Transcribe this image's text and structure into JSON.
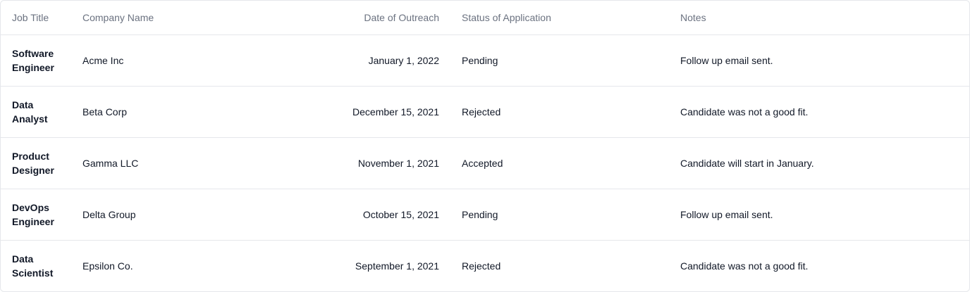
{
  "table": {
    "headers": {
      "job_title": "Job Title",
      "company_name": "Company Name",
      "date_of_outreach": "Date of Outreach",
      "status": "Status of Application",
      "notes": "Notes"
    },
    "rows": [
      {
        "job_title": "Software Engineer",
        "company": "Acme Inc",
        "date": "January 1, 2022",
        "status": "Pending",
        "notes": "Follow up email sent."
      },
      {
        "job_title": "Data Analyst",
        "company": "Beta Corp",
        "date": "December 15, 2021",
        "status": "Rejected",
        "notes": "Candidate was not a good fit."
      },
      {
        "job_title": "Product Designer",
        "company": "Gamma LLC",
        "date": "November 1, 2021",
        "status": "Accepted",
        "notes": "Candidate will start in January."
      },
      {
        "job_title": "DevOps Engineer",
        "company": "Delta Group",
        "date": "October 15, 2021",
        "status": "Pending",
        "notes": "Follow up email sent."
      },
      {
        "job_title": "Data Scientist",
        "company": "Epsilon Co.",
        "date": "September 1, 2021",
        "status": "Rejected",
        "notes": "Candidate was not a good fit."
      }
    ]
  }
}
